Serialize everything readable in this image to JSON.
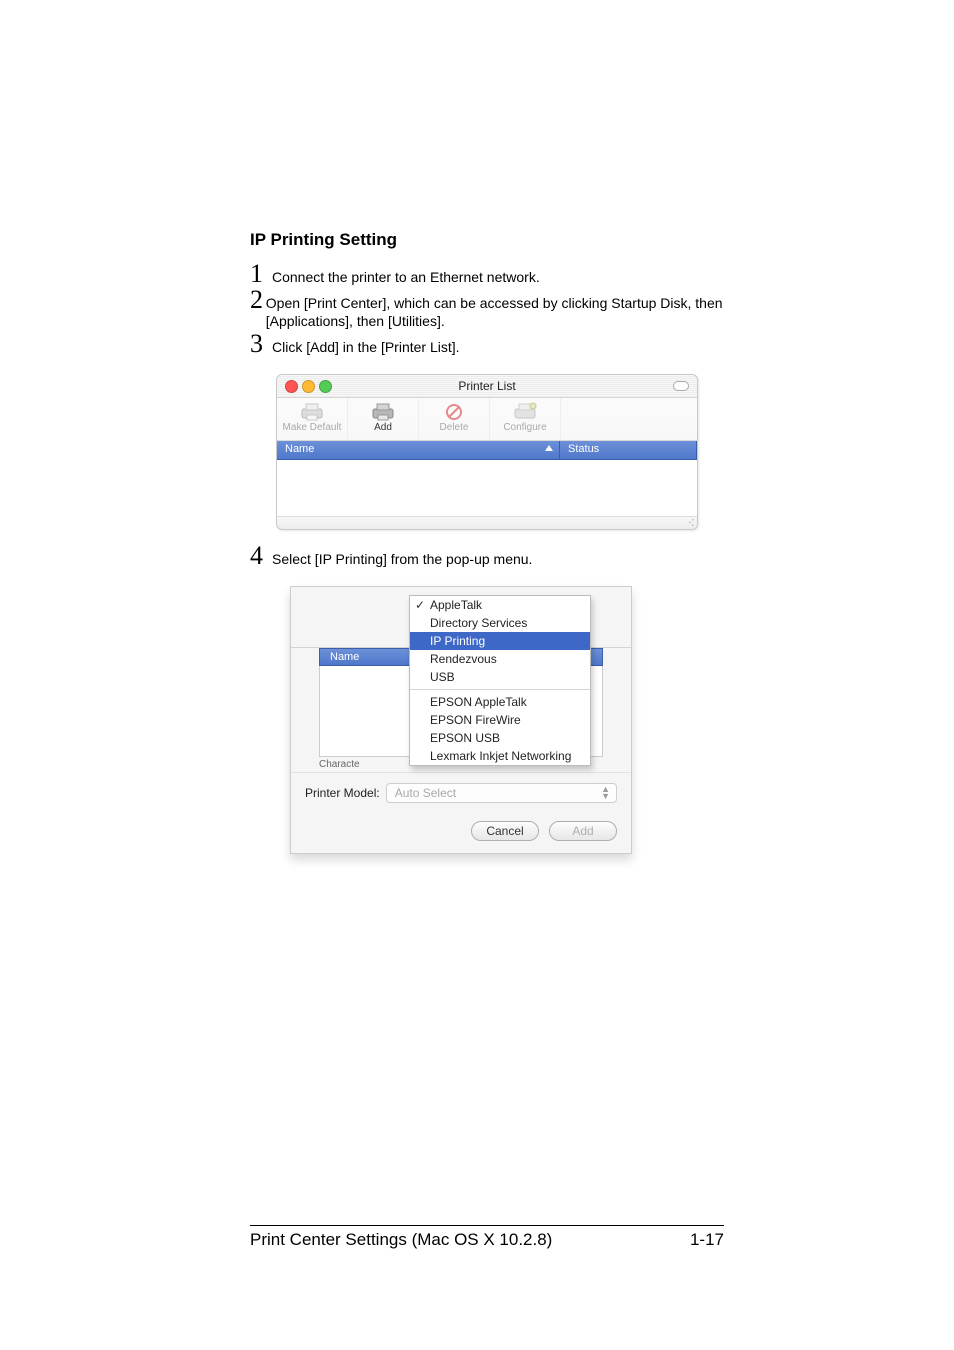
{
  "heading": "IP Printing Setting",
  "steps": {
    "s1": "Connect the printer to an Ethernet network.",
    "s2": "Open [Print Center], which can be accessed by clicking Startup Disk, then [Applications], then [Utilities].",
    "s3": "Click [Add] in the [Printer List].",
    "s4": "Select [IP Printing] from the pop-up menu."
  },
  "printerList": {
    "title": "Printer List",
    "toolbar": {
      "makeDefault": "Make Default",
      "add": "Add",
      "delete": "Delete",
      "configure": "Configure"
    },
    "columns": {
      "name": "Name",
      "status": "Status"
    }
  },
  "popupMenu": {
    "items": {
      "appleTalk": "AppleTalk",
      "directoryServices": "Directory Services",
      "ipPrinting": "IP Printing",
      "rendezvous": "Rendezvous",
      "usb": "USB",
      "epsonAppleTalk": "EPSON AppleTalk",
      "epsonFireWire": "EPSON FireWire",
      "epsonUsb": "EPSON USB",
      "lexmark": "Lexmark Inkjet Networking"
    },
    "listHeader": "Name",
    "characterLabel": "Characte",
    "printerModelLabel": "Printer Model:",
    "printerModelValue": "Auto Select",
    "cancel": "Cancel",
    "add": "Add"
  },
  "footer": {
    "section": "Print Center Settings (Mac OS X 10.2.8)",
    "page": "1-17"
  }
}
